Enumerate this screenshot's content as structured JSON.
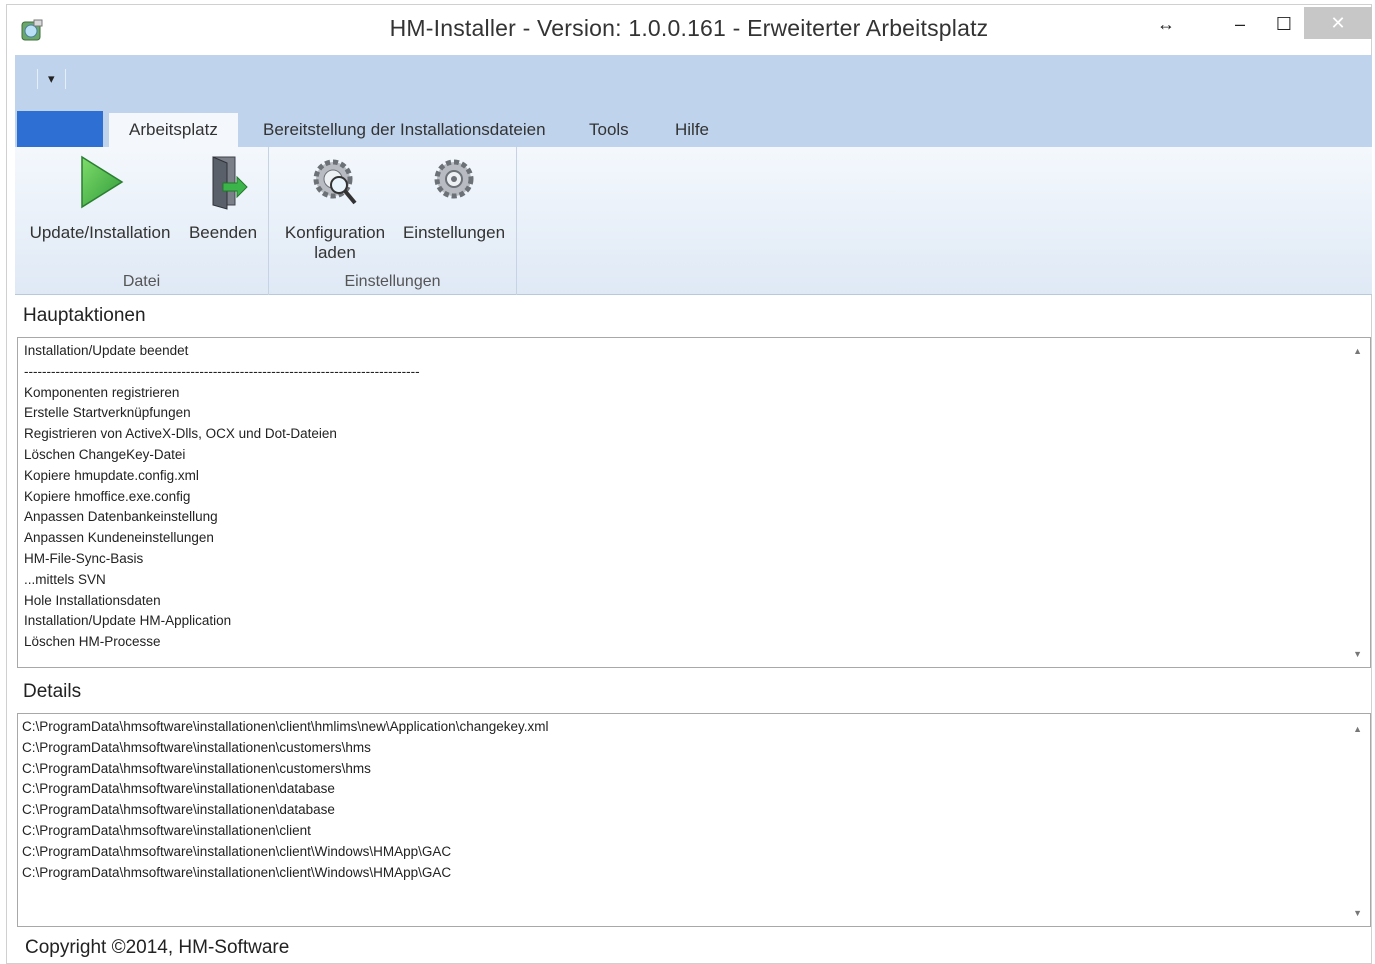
{
  "window": {
    "title": "HM-Installer  - Version: 1.0.0.161  - Erweiterter Arbeitsplatz",
    "controls": {
      "resize": "↔",
      "minimize": "–",
      "maximize": "☐",
      "close": "✕"
    }
  },
  "ribbon": {
    "tabs": [
      {
        "label": "Arbeitsplatz",
        "active": true
      },
      {
        "label": "Bereitstellung der Installationsdateien",
        "active": false
      },
      {
        "label": "Tools",
        "active": false
      },
      {
        "label": "Hilfe",
        "active": false
      }
    ],
    "groups": {
      "datei": {
        "label": "Datei",
        "buttons": {
          "update": "Update/Installation",
          "beenden": "Beenden"
        }
      },
      "einstellungen": {
        "label": "Einstellungen",
        "buttons": {
          "konfiguration_line1": "Konfiguration",
          "konfiguration_line2": "laden",
          "einstellungen": "Einstellungen"
        }
      }
    }
  },
  "hauptaktionen": {
    "label": "Hauptaktionen",
    "lines": [
      "Installation/Update beendet",
      "----------------------------------------------------------------------------------------",
      "Komponenten registrieren",
      "Erstelle Startverknüpfungen",
      "Registrieren von ActiveX-Dlls, OCX und Dot-Dateien",
      "Löschen ChangeKey-Datei",
      "Kopiere hmupdate.config.xml",
      "Kopiere hmoffice.exe.config",
      "Anpassen Datenbankeinstellung",
      "Anpassen Kundeneinstellungen",
      "HM-File-Sync-Basis",
      "...mittels SVN",
      "Hole Installationsdaten",
      "Installation/Update HM-Application",
      "Löschen HM-Processe"
    ]
  },
  "details": {
    "label": "Details",
    "lines": [
      "C:\\ProgramData\\hmsoftware\\installationen\\client\\hmlims\\new\\Application\\changekey.xml",
      "C:\\ProgramData\\hmsoftware\\installationen\\customers\\hms",
      "C:\\ProgramData\\hmsoftware\\installationen\\customers\\hms",
      "C:\\ProgramData\\hmsoftware\\installationen\\database",
      "C:\\ProgramData\\hmsoftware\\installationen\\database",
      "C:\\ProgramData\\hmsoftware\\installationen\\client",
      "C:\\ProgramData\\hmsoftware\\installationen\\client\\Windows\\HMApp\\GAC",
      "C:\\ProgramData\\hmsoftware\\installationen\\client\\Windows\\HMApp\\GAC"
    ]
  },
  "footer": {
    "copyright": "Copyright ©2014, HM-Software"
  },
  "colors": {
    "ribbon": "#bfd3ec",
    "file_tab": "#2d6fd3",
    "play_green": "#3bb54a"
  }
}
